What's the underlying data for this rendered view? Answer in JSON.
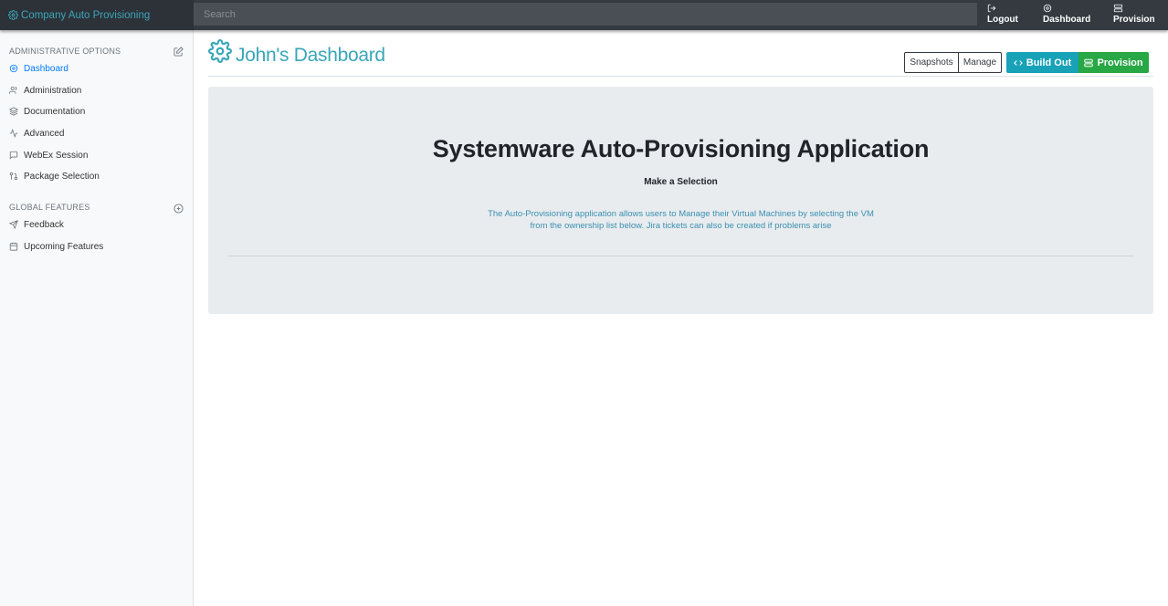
{
  "topbar": {
    "brand": "Company Auto Provisioning",
    "search_placeholder": "Search",
    "nav": [
      {
        "label": "Logout",
        "icon": "logout-icon"
      },
      {
        "label": "Dashboard",
        "icon": "gear-icon"
      },
      {
        "label": "Provision",
        "icon": "server-icon"
      }
    ]
  },
  "sidebar": {
    "admin_heading": "ADMINISTRATIVE OPTIONS",
    "admin_items": [
      {
        "label": "Dashboard",
        "icon": "gear-icon",
        "active": true
      },
      {
        "label": "Administration",
        "icon": "users-icon"
      },
      {
        "label": "Documentation",
        "icon": "layers-icon"
      },
      {
        "label": "Advanced",
        "icon": "activity-icon"
      },
      {
        "label": "WebEx Session",
        "icon": "message-icon"
      },
      {
        "label": "Package Selection",
        "icon": "git-pull-icon"
      }
    ],
    "global_heading": "GLOBAL FEATURES",
    "global_items": [
      {
        "label": "Feedback",
        "icon": "send-icon"
      },
      {
        "label": "Upcoming Features",
        "icon": "calendar-icon"
      }
    ]
  },
  "main": {
    "title": "John's Dashboard",
    "buttons": {
      "snapshots": "Snapshots",
      "manage": "Manage",
      "build_out": "Build Out",
      "provision": "Provision"
    },
    "jumbotron": {
      "heading": "Systemware Auto-Provisioning Application",
      "subheading": "Make a Selection",
      "lead_line1": "The Auto-Provisioning application allows users to Manage their Virtual Machines by selecting the VM",
      "lead_line2": "from the ownership list below. Jira tickets can also be created if problems arise"
    }
  },
  "colors": {
    "accent": "#3aa6b9",
    "topbar": "#343a40",
    "build_out": "#17a2b8",
    "provision": "#28a745",
    "active_link": "#007bff"
  }
}
